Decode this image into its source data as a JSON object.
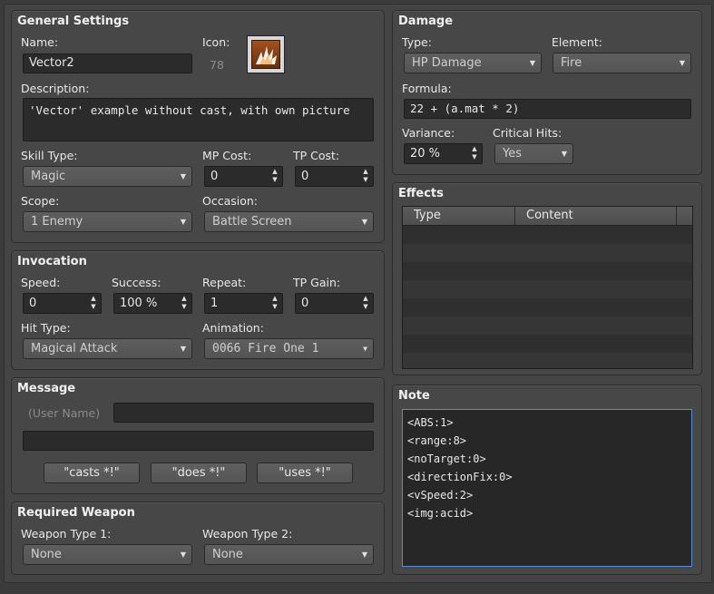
{
  "general": {
    "title": "General Settings",
    "name_label": "Name:",
    "name_value": "Vector2",
    "icon_label": "Icon:",
    "icon_index": "78",
    "icon_name": "fire-burst-icon",
    "description_label": "Description:",
    "description_value": "'Vector' example without cast, with own picture",
    "skill_type_label": "Skill Type:",
    "skill_type_value": "Magic",
    "mp_cost_label": "MP Cost:",
    "mp_cost_value": "0",
    "tp_cost_label": "TP Cost:",
    "tp_cost_value": "0",
    "scope_label": "Scope:",
    "scope_value": "1 Enemy",
    "occasion_label": "Occasion:",
    "occasion_value": "Battle Screen"
  },
  "invocation": {
    "title": "Invocation",
    "speed_label": "Speed:",
    "speed_value": "0",
    "success_label": "Success:",
    "success_value": "100 %",
    "repeat_label": "Repeat:",
    "repeat_value": "1",
    "tp_gain_label": "TP Gain:",
    "tp_gain_value": "0",
    "hit_type_label": "Hit Type:",
    "hit_type_value": "Magical Attack",
    "animation_label": "Animation:",
    "animation_value": "0066 Fire One 1"
  },
  "message": {
    "title": "Message",
    "user_name_label": "(User Name)",
    "line1_value": "",
    "line2_value": "",
    "casts_button": "\"casts *!\"",
    "does_button": "\"does *!\"",
    "uses_button": "\"uses *!\""
  },
  "required_weapon": {
    "title": "Required Weapon",
    "type1_label": "Weapon Type 1:",
    "type1_value": "None",
    "type2_label": "Weapon Type 2:",
    "type2_value": "None"
  },
  "damage": {
    "title": "Damage",
    "type_label": "Type:",
    "type_value": "HP Damage",
    "element_label": "Element:",
    "element_value": "Fire",
    "formula_label": "Formula:",
    "formula_value": "22 + (a.mat * 2)",
    "variance_label": "Variance:",
    "variance_value": "20 %",
    "critical_label": "Critical Hits:",
    "critical_value": "Yes"
  },
  "effects": {
    "title": "Effects",
    "columns": [
      "Type",
      "Content"
    ],
    "rows": []
  },
  "note": {
    "title": "Note",
    "lines": [
      "<ABS:1>",
      "<range:8>",
      "<noTarget:0>",
      "<directionFix:0>",
      "<vSpeed:2>",
      "<img:acid>"
    ]
  },
  "colors": {
    "panel_bg": "#474747",
    "field_bg": "#2b2b2b",
    "note_focus_border": "#5a8ccf",
    "icon_accent": "#a0521f"
  }
}
